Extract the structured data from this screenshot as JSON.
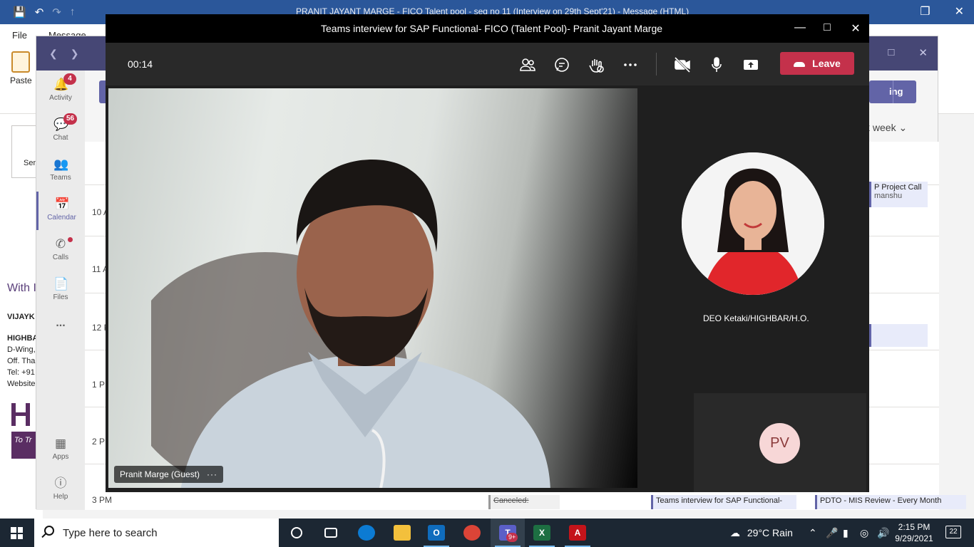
{
  "outlook": {
    "title": "PRANIT JAYANT MARGE - FICO Talent pool - seq no 11 (Interview on 29th Sept'21)  -  Message (HTML)",
    "menu": {
      "file": "File",
      "message": "Message"
    },
    "paste_label": "Paste",
    "send_label": "Sen",
    "signature": {
      "greeting": "With I",
      "name": "VIJAYK",
      "company": "HIGHBA",
      "line1": "D-Wing,",
      "line2": "Off. Tha",
      "line3": "Tel: +91",
      "line4": "Website"
    },
    "logo_tag": "To Tr"
  },
  "teams": {
    "rail": [
      {
        "label": "Activity",
        "icon": "bell-icon",
        "badge": "4"
      },
      {
        "label": "Chat",
        "icon": "chat-icon",
        "badge": "56"
      },
      {
        "label": "Teams",
        "icon": "teams-icon"
      },
      {
        "label": "Calendar",
        "icon": "calendar-icon",
        "active": true
      },
      {
        "label": "Calls",
        "icon": "phone-icon",
        "dot": true
      },
      {
        "label": "Files",
        "icon": "file-icon"
      },
      {
        "label": "...",
        "icon": "more-icon"
      },
      {
        "label": "Apps",
        "icon": "apps-icon"
      },
      {
        "label": "Help",
        "icon": "help-icon"
      }
    ],
    "calendar": {
      "meet_button_label": "ing",
      "view_label": "k week",
      "times": [
        "10 A",
        "11 A",
        "12 P",
        "1 P",
        "2 P",
        "3 PM"
      ],
      "events": {
        "project_call": "P Project Call",
        "project_call_sub": "manshu",
        "canceled": "Canceled:",
        "teams_interview": "Teams interview for SAP Functional-",
        "pdto": "PDTO - MIS Review - Every Month"
      }
    }
  },
  "meeting": {
    "title": "Teams interview for SAP Functional- FICO (Talent Pool)- Pranit Jayant Marge",
    "timer": "00:14",
    "leave_label": "Leave",
    "participants": [
      {
        "name": "Pranit Marge (Guest)",
        "more": "···"
      },
      {
        "name": "DEO Ketaki/HIGHBAR/H.O."
      },
      {
        "initials": "PV"
      }
    ]
  },
  "taskbar": {
    "search_placeholder": "Type here to search",
    "weather": "29°C  Rain",
    "time": "2:15 PM",
    "date": "9/29/2021",
    "notifications": "22",
    "teams_badge": "9+"
  }
}
